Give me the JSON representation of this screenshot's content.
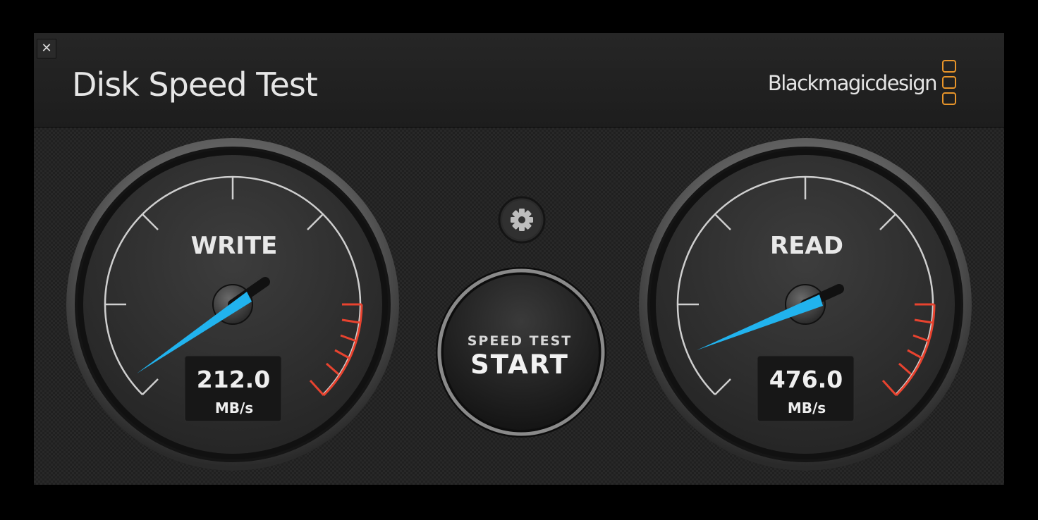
{
  "window": {
    "close_icon": "✕",
    "title": "Disk Speed Test",
    "brand": "Blackmagicdesign",
    "brand_color": "#e8952a"
  },
  "controls": {
    "settings_icon": "gear-icon",
    "start_button": {
      "line1": "SPEED TEST",
      "line2": "START"
    }
  },
  "gauges": [
    {
      "id": "write",
      "label": "WRITE",
      "value": "212.0",
      "unit": "MB/s",
      "needle_angle_deg": -37
    },
    {
      "id": "read",
      "label": "READ",
      "value": "476.0",
      "unit": "MB/s",
      "needle_angle_deg": -21
    }
  ],
  "colors": {
    "needle": "#21b3ee",
    "redline": "#e8432f",
    "tick": "#cfcfcf"
  }
}
